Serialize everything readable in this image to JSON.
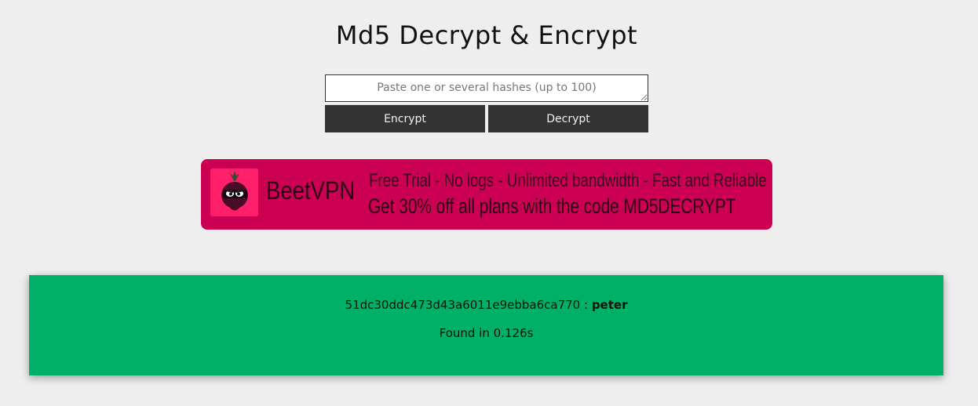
{
  "page": {
    "title": "Md5 Decrypt & Encrypt"
  },
  "form": {
    "placeholder": "Paste one or several hashes (up to 100)",
    "value": "",
    "encrypt_label": "Encrypt",
    "decrypt_label": "Decrypt"
  },
  "ad": {
    "brand": "BeetVPN",
    "line1": "Free Trial - No logs - Unlimited bandwidth - Fast and Reliable",
    "line2": "Get 30% off all plans with the code MD5DECRYPT",
    "logo_icon": "beet-ninja-logo-icon",
    "colors": {
      "background": "#cc0052",
      "logo_bg": "#ff1f6b"
    }
  },
  "result": {
    "hash": "51dc30ddc473d43a6011e9ebba6ca770",
    "separator": " : ",
    "plaintext": "peter",
    "time_text": "Found in 0.126s",
    "colors": {
      "background": "#00b067"
    }
  },
  "colors": {
    "page_background": "#eeeeee",
    "button_background": "#333333",
    "button_text": "#f2f2f2"
  }
}
